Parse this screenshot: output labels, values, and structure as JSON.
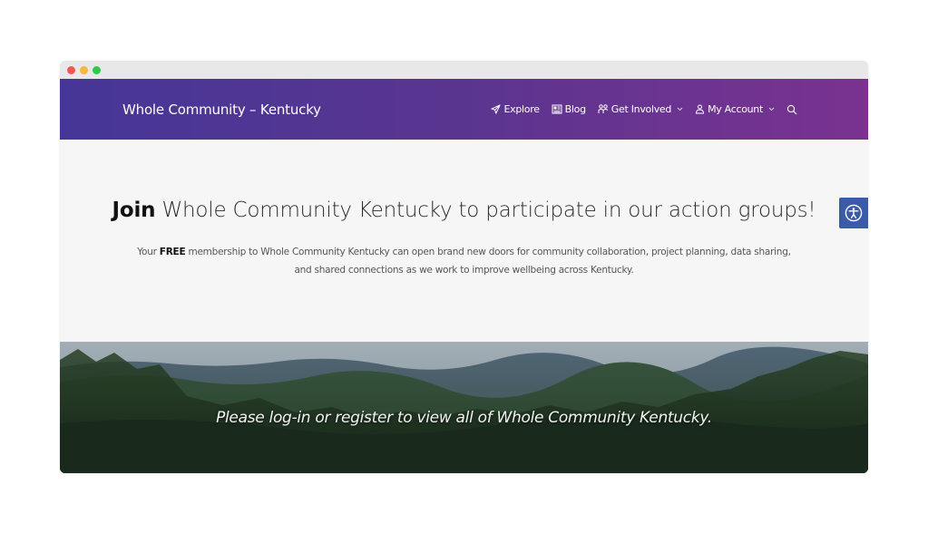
{
  "browser": {
    "controls": [
      "close",
      "minimize",
      "maximize"
    ]
  },
  "header": {
    "site_title": "Whole Community – Kentucky",
    "nav": [
      {
        "label": "Explore",
        "icon": "paper-plane-icon"
      },
      {
        "label": "Blog",
        "icon": "newspaper-icon"
      },
      {
        "label": "Get Involved",
        "icon": "people-icon",
        "dropdown": true
      },
      {
        "label": "My Account",
        "icon": "user-icon",
        "dropdown": true
      }
    ],
    "search_icon": "search-icon"
  },
  "hero": {
    "heading_bold": "Join",
    "heading_rest": " Whole Community Kentucky to participate in our action groups!",
    "text_pre": "Your ",
    "text_bold": "FREE",
    "text_post": " membership to Whole Community Kentucky can open brand new doors for community collaboration, project planning, data sharing, and shared connections as we work to improve wellbeing across Kentucky."
  },
  "banner": {
    "message": "Please log-in or register to view all of Whole Community Kentucky."
  },
  "accessibility": {
    "icon": "accessibility-icon"
  },
  "colors": {
    "header_start": "#463697",
    "header_end": "#7a3290",
    "accessibility_button": "#3a5ba8",
    "page_bg": "#f6f6f6"
  }
}
